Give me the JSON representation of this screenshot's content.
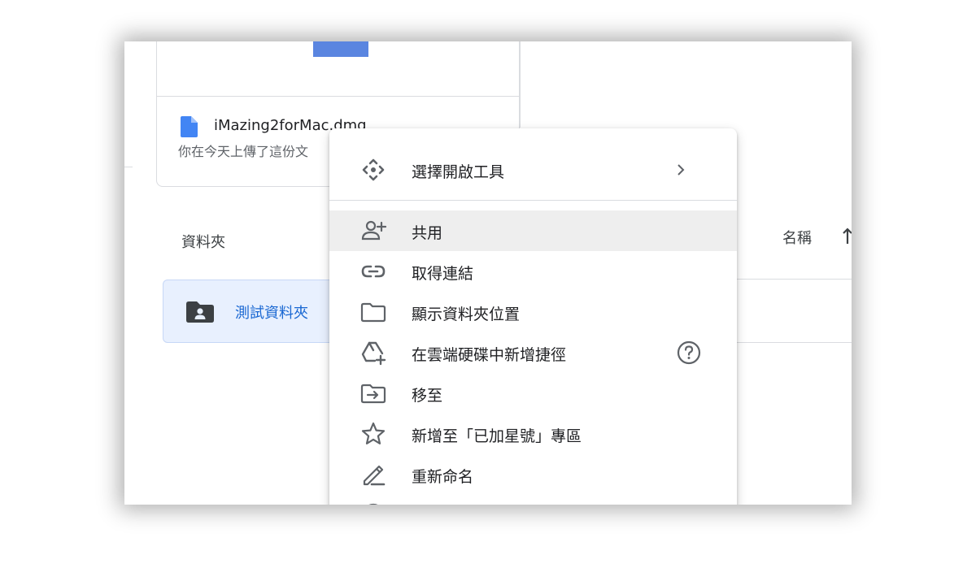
{
  "file_card": {
    "file_name": "iMazing2forMac.dmg",
    "subtitle": "你在今天上傳了這份文"
  },
  "folders_section": {
    "label": "資料夾",
    "folder_name": "測試資料夾"
  },
  "list_header": {
    "name_label": "名稱"
  },
  "context_menu": {
    "open_with": "選擇開啟工具",
    "share": "共用",
    "get_link": "取得連結",
    "show_location": "顯示資料夾位置",
    "add_shortcut": "在雲端硬碟中新增捷徑",
    "move_to": "移至",
    "add_starred": "新增至「已加星號」專區",
    "rename": "重新命名"
  },
  "colors": {
    "accent_blue": "#1967d2",
    "file_icon_blue": "#4285f4",
    "folder_chip_bg": "#e8f0fe",
    "highlight_row": "#eeeeee"
  },
  "icons": {
    "open_with": "move-arrows-icon",
    "share": "person-add-icon",
    "get_link": "link-icon",
    "show_location": "folder-outline-icon",
    "add_shortcut": "drive-shortcut-add-icon",
    "move_to": "folder-move-icon",
    "add_starred": "star-outline-icon",
    "rename": "pencil-icon",
    "help": "help-circle-icon"
  }
}
